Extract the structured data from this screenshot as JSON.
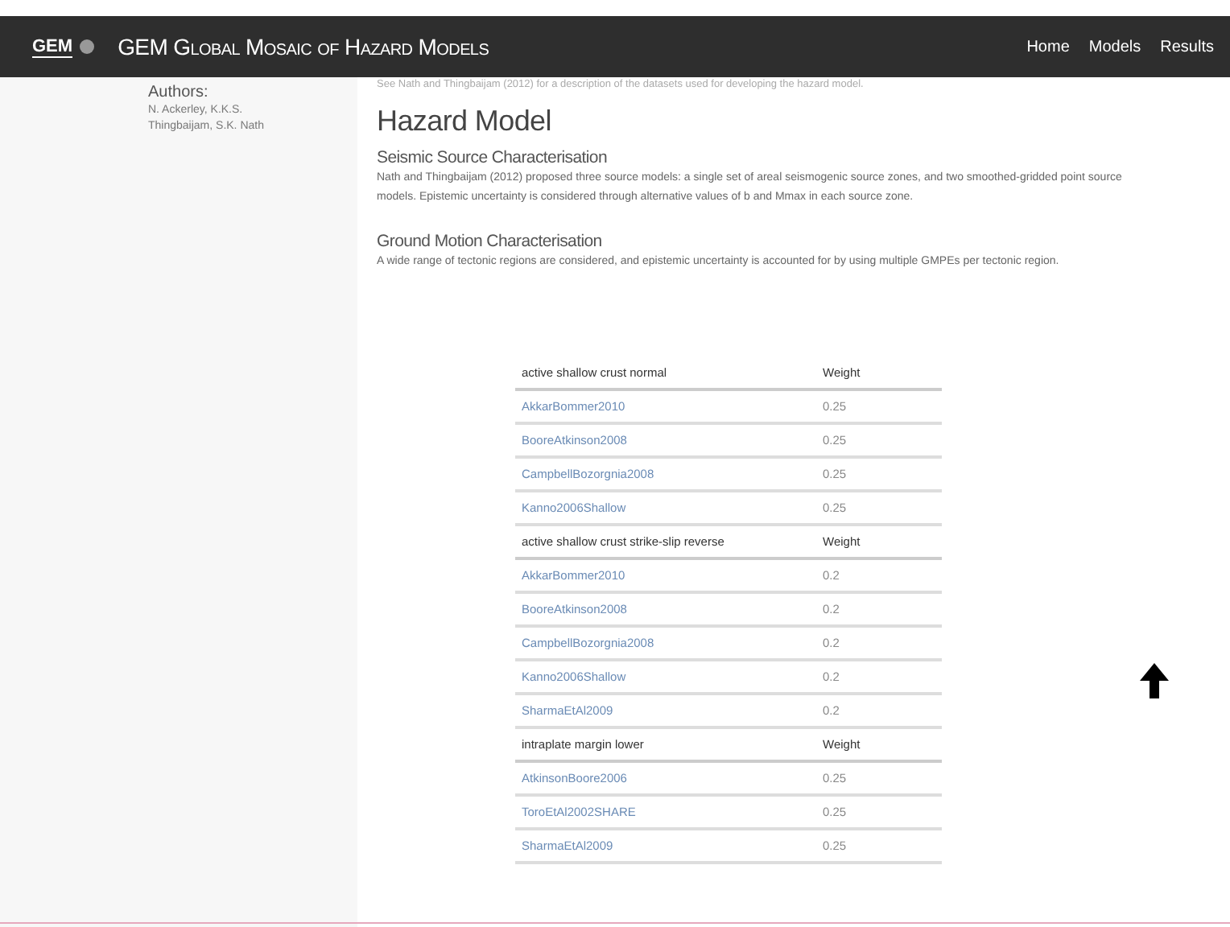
{
  "navbar": {
    "logo": "GEM",
    "title": "GEM Global Mosaic of Hazard Models",
    "links": [
      "Home",
      "Models",
      "Results"
    ]
  },
  "sidebar": {
    "heading": "Authors:",
    "authors": "N. Ackerley, K.K.S. Thingbaijam, S.K. Nath"
  },
  "intro": "See Nath and Thingbaijam (2012) for a description of the datasets used for developing the hazard model.",
  "title": "Hazard Model",
  "sections": [
    {
      "heading": "Seismic Source Characterisation",
      "text": "Nath and Thingbaijam (2012) proposed three source models: a single set of areal seismogenic source zones, and two smoothed-gridded point source models. Epistemic uncertainty is considered through alternative values of b and Mmax in each source zone."
    },
    {
      "heading": "Ground Motion Characterisation",
      "text": "A wide range of tectonic regions are considered, and epistemic uncertainty is accounted for by using multiple GMPEs per tectonic region."
    }
  ],
  "gmpe_tables": [
    {
      "region": "active shallow crust normal",
      "weight_heading": "Weight",
      "rows": [
        {
          "gmpe": "AkkarBommer2010",
          "weight": "0.25"
        },
        {
          "gmpe": "BooreAtkinson2008",
          "weight": "0.25"
        },
        {
          "gmpe": "CampbellBozorgnia2008",
          "weight": "0.25"
        },
        {
          "gmpe": "Kanno2006Shallow",
          "weight": "0.25"
        }
      ]
    },
    {
      "region": "active shallow crust strike-slip reverse",
      "weight_heading": "Weight",
      "rows": [
        {
          "gmpe": "AkkarBommer2010",
          "weight": "0.2"
        },
        {
          "gmpe": "BooreAtkinson2008",
          "weight": "0.2"
        },
        {
          "gmpe": "CampbellBozorgnia2008",
          "weight": "0.2"
        },
        {
          "gmpe": "Kanno2006Shallow",
          "weight": "0.2"
        },
        {
          "gmpe": "SharmaEtAl2009",
          "weight": "0.2"
        }
      ]
    },
    {
      "region": "intraplate margin lower",
      "weight_heading": "Weight",
      "rows": [
        {
          "gmpe": "AtkinsonBoore2006",
          "weight": "0.25"
        },
        {
          "gmpe": "ToroEtAl2002SHARE",
          "weight": "0.25"
        },
        {
          "gmpe": "SharmaEtAl2009",
          "weight": "0.25"
        }
      ]
    }
  ]
}
